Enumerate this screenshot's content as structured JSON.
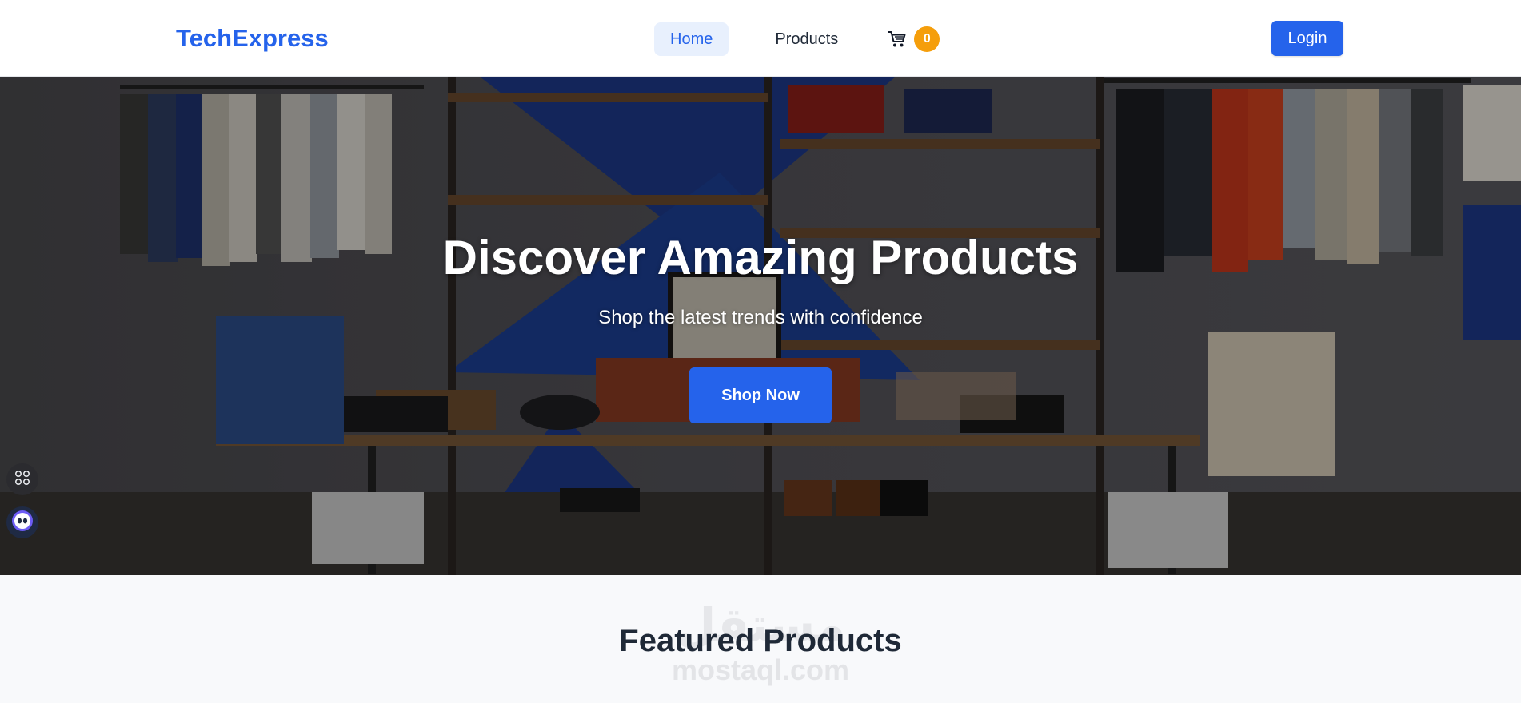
{
  "header": {
    "brand": "TechExpress",
    "nav": [
      {
        "label": "Home",
        "active": true
      },
      {
        "label": "Products",
        "active": false
      }
    ],
    "cart": {
      "icon": "shopping-cart-icon",
      "count": "0"
    },
    "login_label": "Login"
  },
  "hero": {
    "title": "Discover Amazing Products",
    "subtitle": "Shop the latest trends with confidence",
    "cta_label": "Shop Now"
  },
  "floating": {
    "apps_icon": "grid-icon",
    "assistant_icon": "bot-icon"
  },
  "featured": {
    "title": "Featured Products",
    "watermark_ar": "مستقل",
    "watermark_en": "mostaql.com"
  },
  "colors": {
    "brand": "#2563eb",
    "nav_active_bg": "#e8f0fd",
    "badge": "#f59e0b",
    "section_bg": "#f8f9fb",
    "heading": "#1f2937"
  }
}
